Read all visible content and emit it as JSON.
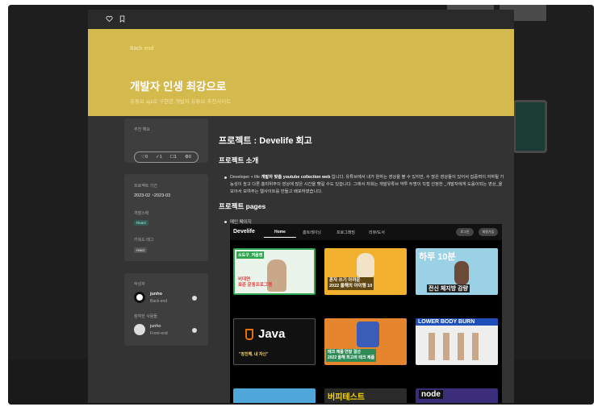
{
  "modal": {
    "back_label": "Back end",
    "hero_title": "개발자 인생 최강으로",
    "hero_subtitle": "유튜브 api로 구현한 개발자 유튜브 추천사이트"
  },
  "sidebar": {
    "recommend_label": "추천 해요",
    "stats": {
      "likes": "0",
      "checks": "1",
      "comments": "1",
      "settings": "0"
    },
    "period_label": "프로젝트 기간",
    "period_value": "2023-02 ~2023-03",
    "stack_label": "개발스택",
    "stack_chip": "React",
    "keyword_label": "키워드 태그",
    "keyword_chip": "react",
    "author_label": "작성자",
    "author_name": "junho",
    "author_role": "Back-end",
    "participants_label": "참여한 사람들",
    "participant_name": "junho",
    "participant_role": "Front-end"
  },
  "content": {
    "heading": "프로젝트 : Develife 회고",
    "intro_heading": "프로젝트 소개",
    "intro_text_1": "Developer + life ",
    "intro_text_bold": "개발자 맞춤 youtube collection web",
    "intro_text_2": " 입니다. 유튜브에서 내가 원하는 영상을 볼 수 있지만, 수 많은 영상들이 있어서 집중력이 저하될 가능성이 높고 다른 흥미위주의 영상에 많은 시간을 뺏길 수도 있습니다. 그래서 저희는 개발유튜브 약투 두명이 직접 선정한 _개발자에게 도움이되는 영상_을 모아서 보여주는 웹사이트를 만들고 배포하였습니다.",
    "pages_heading": "프로젝트 pages",
    "pages_item": "메인 페이지"
  },
  "screenshot": {
    "logo": "Develife",
    "tabs": [
      "Home",
      "홈트레이닝",
      "프로그래밍",
      "리뷰/도서"
    ],
    "login": "로그인",
    "signup": "회원가입",
    "thumbs": [
      {
        "top": "소도구_처음엔",
        "caption": "비대면\n표준 운동프로그램",
        "bg": "#eaf4ea"
      },
      {
        "top": "",
        "caption": "혼자 쓰기 아까운\n2022 올해의 아이템 10",
        "bg": "#f1b12f"
      },
      {
        "top": "하루 10분",
        "caption": "전신 체지방 감량",
        "bg": "#9ad1e5"
      },
      {
        "top": "Java",
        "caption": "\"정진해, 내 자신\"",
        "bg": "#111111"
      },
      {
        "top": "",
        "caption": "테크 제품 연말 결산\n2022 올해 최고의 테크 제품",
        "bg": "#e5862e"
      },
      {
        "top": "LOWER BODY BURN",
        "caption": "",
        "bg": "#eeeeee"
      },
      {
        "top": "",
        "caption": "",
        "bg": "#4fa7d9"
      },
      {
        "top": "버피테스트",
        "caption": "",
        "bg": "#2a2a2a"
      },
      {
        "top": "node",
        "caption": "",
        "bg": "#3b2d7a"
      }
    ]
  },
  "colors": {
    "hero": "#d4b94d",
    "accent": "#2e8b57"
  }
}
